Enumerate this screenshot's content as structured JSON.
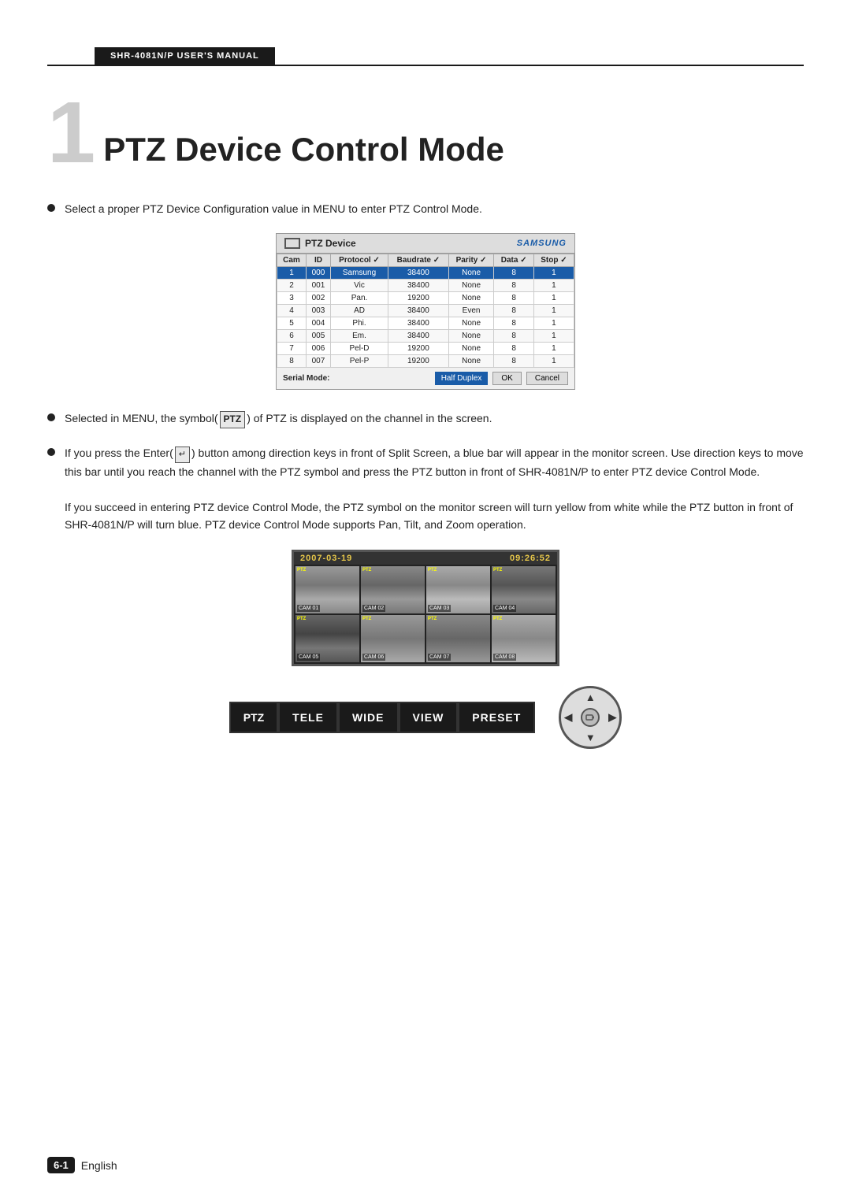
{
  "header": {
    "manual_title": "SHR-4081N/P USER'S MANUAL"
  },
  "chapter": {
    "number": "1",
    "title": "PTZ Device Control Mode"
  },
  "bullets": [
    {
      "id": "bullet1",
      "text": "Select a proper PTZ Device Configuration value in MENU to enter PTZ Control Mode."
    },
    {
      "id": "bullet2",
      "text": "Selected in MENU, the symbol( PTZ ) of PTZ is displayed on the channel in the screen."
    },
    {
      "id": "bullet3",
      "lines": [
        "If you press the Enter(↵) button among direction keys in front of Split Screen, a blue bar will appear in the monitor screen. Use direction keys to move this bar until you reach the channel with the PTZ symbol and press the PTZ button in front of SHR-4081N/P to enter PTZ device Control Mode.",
        "If you succeed in entering PTZ device Control Mode, the PTZ symbol on the monitor screen will turn yellow from white while the PTZ button in front of SHR-4081N/P will turn blue. PTZ device Control Mode supports Pan, Tilt, and Zoom operation."
      ]
    }
  ],
  "ptz_table": {
    "panel_title": "PTZ Device",
    "samsung_logo": "SAMSUNG",
    "columns": [
      "Cam",
      "ID",
      "Protocol ✓",
      "Baudrate ✓",
      "Parity ✓",
      "Data ✓",
      "Stop ✓"
    ],
    "rows": [
      {
        "cam": "1",
        "id": "000",
        "protocol": "Samsung",
        "baudrate": "38400",
        "parity": "None",
        "data": "8",
        "stop": "1"
      },
      {
        "cam": "2",
        "id": "001",
        "protocol": "Vic",
        "baudrate": "38400",
        "parity": "None",
        "data": "8",
        "stop": "1"
      },
      {
        "cam": "3",
        "id": "002",
        "protocol": "Pan.",
        "baudrate": "19200",
        "parity": "None",
        "data": "8",
        "stop": "1"
      },
      {
        "cam": "4",
        "id": "003",
        "protocol": "AD",
        "baudrate": "38400",
        "parity": "Even",
        "data": "8",
        "stop": "1"
      },
      {
        "cam": "5",
        "id": "004",
        "protocol": "Phi.",
        "baudrate": "38400",
        "parity": "None",
        "data": "8",
        "stop": "1"
      },
      {
        "cam": "6",
        "id": "005",
        "protocol": "Em.",
        "baudrate": "38400",
        "parity": "None",
        "data": "8",
        "stop": "1"
      },
      {
        "cam": "7",
        "id": "006",
        "protocol": "Pel-D",
        "baudrate": "19200",
        "parity": "None",
        "data": "8",
        "stop": "1"
      },
      {
        "cam": "8",
        "id": "007",
        "protocol": "Pel-P",
        "baudrate": "19200",
        "parity": "None",
        "data": "8",
        "stop": "1"
      }
    ],
    "serial_mode_label": "Serial Mode:",
    "half_duplex_label": "Half Duplex",
    "ok_label": "OK",
    "cancel_label": "Cancel"
  },
  "monitor": {
    "date": "2007-03-19",
    "time": "09:26:52",
    "cam_labels": [
      "CAM 01",
      "CAM 02",
      "CAM 03",
      "CAM 04",
      "CAM 05",
      "CAM 06",
      "CAM 07",
      "CAM 08"
    ]
  },
  "buttons": {
    "ptz": "PTZ",
    "tele": "TELE",
    "wide": "WIDE",
    "view": "VIEW",
    "preset": "PRESET"
  },
  "footer": {
    "badge": "6-1",
    "language": "English"
  }
}
